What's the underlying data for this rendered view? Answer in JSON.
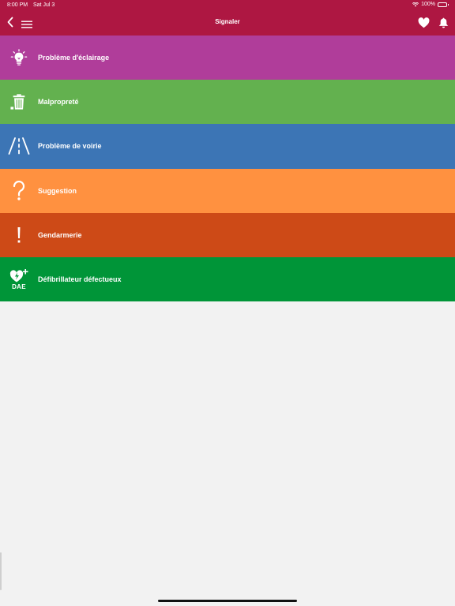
{
  "status_bar": {
    "time": "8:00 PM",
    "date": "Sat Jul 3",
    "battery": "100%"
  },
  "header": {
    "title": "Signaler"
  },
  "categories": [
    {
      "label": "Problème d'éclairage",
      "color": "#b03d9a",
      "icon": "lightbulb-icon"
    },
    {
      "label": "Malpropreté",
      "color": "#63b14f",
      "icon": "trash-icon"
    },
    {
      "label": "Problème de voirie",
      "color": "#3c75b5",
      "icon": "road-icon"
    },
    {
      "label": "Suggestion",
      "color": "#ff9140",
      "icon": "question-mark-icon"
    },
    {
      "label": "Gendarmerie",
      "color": "#cd4a17",
      "icon": "exclamation-icon"
    },
    {
      "label": "Défibrillateur défectueux",
      "color": "#009538",
      "icon": "defibrillator-icon",
      "icon_text": "DAE"
    }
  ],
  "colors": {
    "header": "#ae1742",
    "background": "#f2f2f2"
  }
}
